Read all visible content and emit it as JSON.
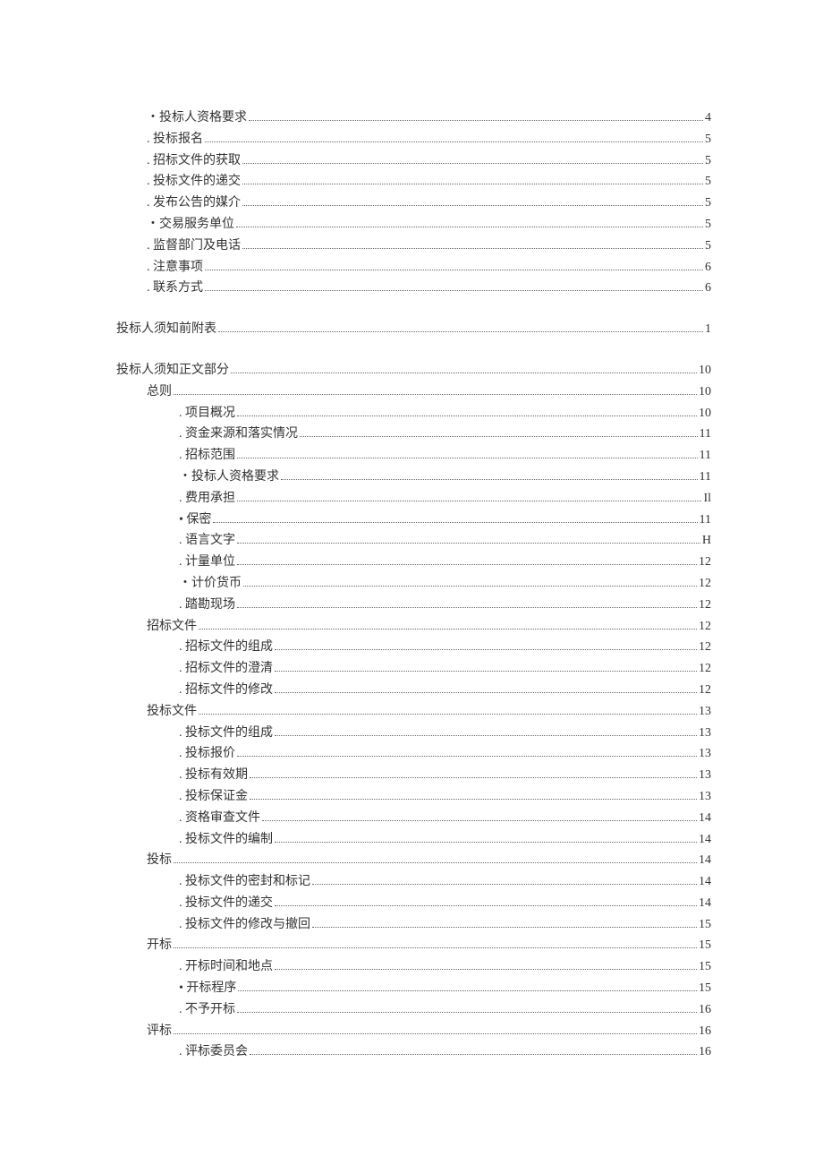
{
  "toc": [
    {
      "indent": 1,
      "label": "・投标人资格要求",
      "page": "4",
      "gap": false
    },
    {
      "indent": 1,
      "label": ". 投标报名",
      "page": "5",
      "gap": false
    },
    {
      "indent": 1,
      "label": ". 招标文件的获取",
      "page": "5",
      "gap": false
    },
    {
      "indent": 1,
      "label": ". 投标文件的递交",
      "page": "5",
      "gap": false
    },
    {
      "indent": 1,
      "label": ". 发布公告的媒介",
      "page": "5",
      "gap": false
    },
    {
      "indent": 1,
      "label": "・交易服务单位",
      "page": "5",
      "gap": false
    },
    {
      "indent": 1,
      "label": ". 监督部门及电话",
      "page": "5",
      "gap": false
    },
    {
      "indent": 1,
      "label": ". 注意事项",
      "page": "6",
      "gap": false
    },
    {
      "indent": 1,
      "label": ". 联系方式",
      "page": "6",
      "gap": false
    },
    {
      "indent": 0,
      "label": "投标人须知前附表",
      "page": "1",
      "gap": true
    },
    {
      "indent": 0,
      "label": "投标人须知正文部分",
      "page": "10",
      "gap": true
    },
    {
      "indent": 1,
      "label": "总则",
      "page": "10",
      "gap": false
    },
    {
      "indent": 2,
      "label": ". 项目概况",
      "page": "10",
      "gap": false
    },
    {
      "indent": 2,
      "label": ". 资金来源和落实情况",
      "page": "11",
      "gap": false
    },
    {
      "indent": 2,
      "label": ". 招标范围",
      "page": "11",
      "gap": false
    },
    {
      "indent": 2,
      "label": "・投标人资格要求",
      "page": "11",
      "gap": false
    },
    {
      "indent": 2,
      "label": ". 费用承担",
      "page": "Il",
      "gap": false
    },
    {
      "indent": 2,
      "label": "• 保密",
      "page": "11",
      "gap": false
    },
    {
      "indent": 2,
      "label": ". 语言文字",
      "page": "H",
      "gap": false
    },
    {
      "indent": 2,
      "label": ". 计量单位",
      "page": "12",
      "gap": false
    },
    {
      "indent": 2,
      "label": "・计价货币",
      "page": "12",
      "gap": false
    },
    {
      "indent": 2,
      "label": ". 踏勘现场",
      "page": "12",
      "gap": false
    },
    {
      "indent": 1,
      "label": "招标文件",
      "page": "12",
      "gap": false
    },
    {
      "indent": 2,
      "label": ". 招标文件的组成",
      "page": "12",
      "gap": false
    },
    {
      "indent": 2,
      "label": ". 招标文件的澄清",
      "page": "12",
      "gap": false
    },
    {
      "indent": 2,
      "label": ". 招标文件的修改",
      "page": "12",
      "gap": false
    },
    {
      "indent": 1,
      "label": "投标文件",
      "page": "13",
      "gap": false
    },
    {
      "indent": 2,
      "label": ". 投标文件的组成",
      "page": "13",
      "gap": false
    },
    {
      "indent": 2,
      "label": ". 投标报价",
      "page": "13",
      "gap": false
    },
    {
      "indent": 2,
      "label": ". 投标有效期",
      "page": "13",
      "gap": false
    },
    {
      "indent": 2,
      "label": ". 投标保证金",
      "page": "13",
      "gap": false
    },
    {
      "indent": 2,
      "label": ". 资格审查文件",
      "page": "14",
      "gap": false
    },
    {
      "indent": 2,
      "label": ". 投标文件的编制",
      "page": "14",
      "gap": false
    },
    {
      "indent": 1,
      "label": "投标",
      "page": "14",
      "gap": false
    },
    {
      "indent": 2,
      "label": ". 投标文件的密封和标记",
      "page": "14",
      "gap": false
    },
    {
      "indent": 2,
      "label": ". 投标文件的递交",
      "page": "14",
      "gap": false
    },
    {
      "indent": 2,
      "label": ". 投标文件的修改与撤回",
      "page": "15",
      "gap": false
    },
    {
      "indent": 1,
      "label": "开标",
      "page": "15",
      "gap": false
    },
    {
      "indent": 2,
      "label": ". 开标时间和地点",
      "page": "15",
      "gap": false
    },
    {
      "indent": 2,
      "label": "• 开标程序",
      "page": "15",
      "gap": false
    },
    {
      "indent": 2,
      "label": ". 不予开标",
      "page": "16",
      "gap": false
    },
    {
      "indent": 1,
      "label": "评标",
      "page": "16",
      "gap": false
    },
    {
      "indent": 2,
      "label": ". 评标委员会",
      "page": "16",
      "gap": false
    }
  ]
}
